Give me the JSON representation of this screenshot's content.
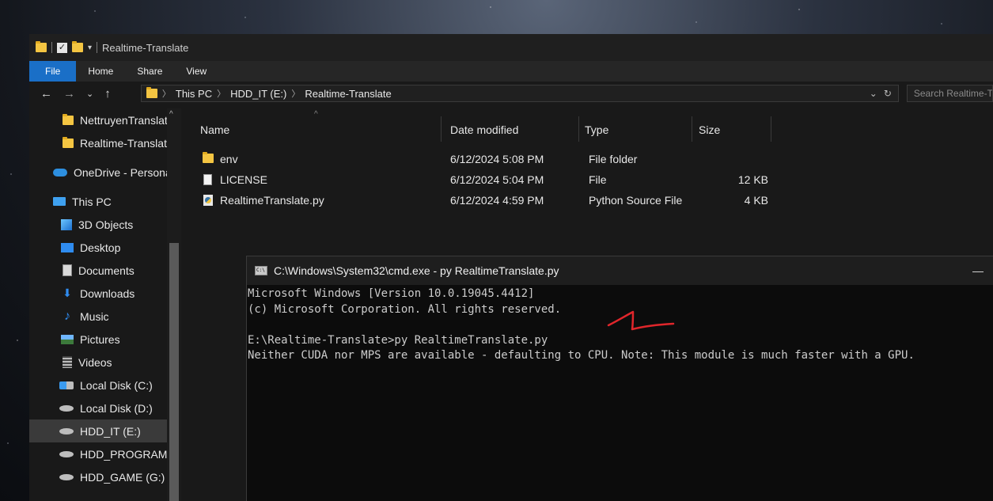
{
  "explorer": {
    "title": "Realtime-Translate",
    "ribbon_tabs": [
      "File",
      "Home",
      "Share",
      "View"
    ],
    "address": {
      "crumbs": [
        "This PC",
        "HDD_IT (E:)",
        "Realtime-Translate"
      ],
      "search_placeholder": "Search Realtime-Translate"
    },
    "sidebar": {
      "items": [
        {
          "label": "NettruyenTranslate",
          "icon": "folder-icon"
        },
        {
          "label": "Realtime-Translate",
          "icon": "folder-icon"
        },
        {
          "label": "OneDrive - Personal",
          "icon": "onedrive-icon"
        },
        {
          "label": "This PC",
          "icon": "computer-icon"
        },
        {
          "label": "3D Objects",
          "icon": "3d-objects-icon"
        },
        {
          "label": "Desktop",
          "icon": "desktop-icon"
        },
        {
          "label": "Documents",
          "icon": "documents-icon"
        },
        {
          "label": "Downloads",
          "icon": "downloads-icon"
        },
        {
          "label": "Music",
          "icon": "music-icon"
        },
        {
          "label": "Pictures",
          "icon": "pictures-icon"
        },
        {
          "label": "Videos",
          "icon": "videos-icon"
        },
        {
          "label": "Local Disk (C:)",
          "icon": "system-disk-icon"
        },
        {
          "label": "Local Disk (D:)",
          "icon": "disk-icon"
        },
        {
          "label": "HDD_IT (E:)",
          "icon": "disk-icon",
          "selected": true
        },
        {
          "label": "HDD_PROGRAM",
          "icon": "disk-icon"
        },
        {
          "label": "HDD_GAME (G:)",
          "icon": "disk-icon"
        }
      ]
    },
    "columns": [
      "Name",
      "Date modified",
      "Type",
      "Size"
    ],
    "files": [
      {
        "name": "env",
        "date": "6/12/2024 5:08 PM",
        "type": "File folder",
        "size": "",
        "icon": "folder-icon"
      },
      {
        "name": "LICENSE",
        "date": "6/12/2024 5:04 PM",
        "type": "File",
        "size": "12 KB",
        "icon": "file-icon"
      },
      {
        "name": "RealtimeTranslate.py",
        "date": "6/12/2024 4:59 PM",
        "type": "Python Source File",
        "size": "4 KB",
        "icon": "python-file-icon"
      }
    ]
  },
  "cmd": {
    "title": "C:\\Windows\\System32\\cmd.exe - py  RealtimeTranslate.py",
    "lines": [
      "Microsoft Windows [Version 10.0.19045.4412]",
      "(c) Microsoft Corporation. All rights reserved.",
      "",
      "E:\\Realtime-Translate>py RealtimeTranslate.py",
      "Neither CUDA nor MPS are available - defaulting to CPU. Note: This module is much faster with a GPU."
    ],
    "annotation": "1",
    "annotation_color": "#e0262b"
  },
  "colors": {
    "file_tab": "#1a6fc7",
    "folder": "#f4c542"
  }
}
